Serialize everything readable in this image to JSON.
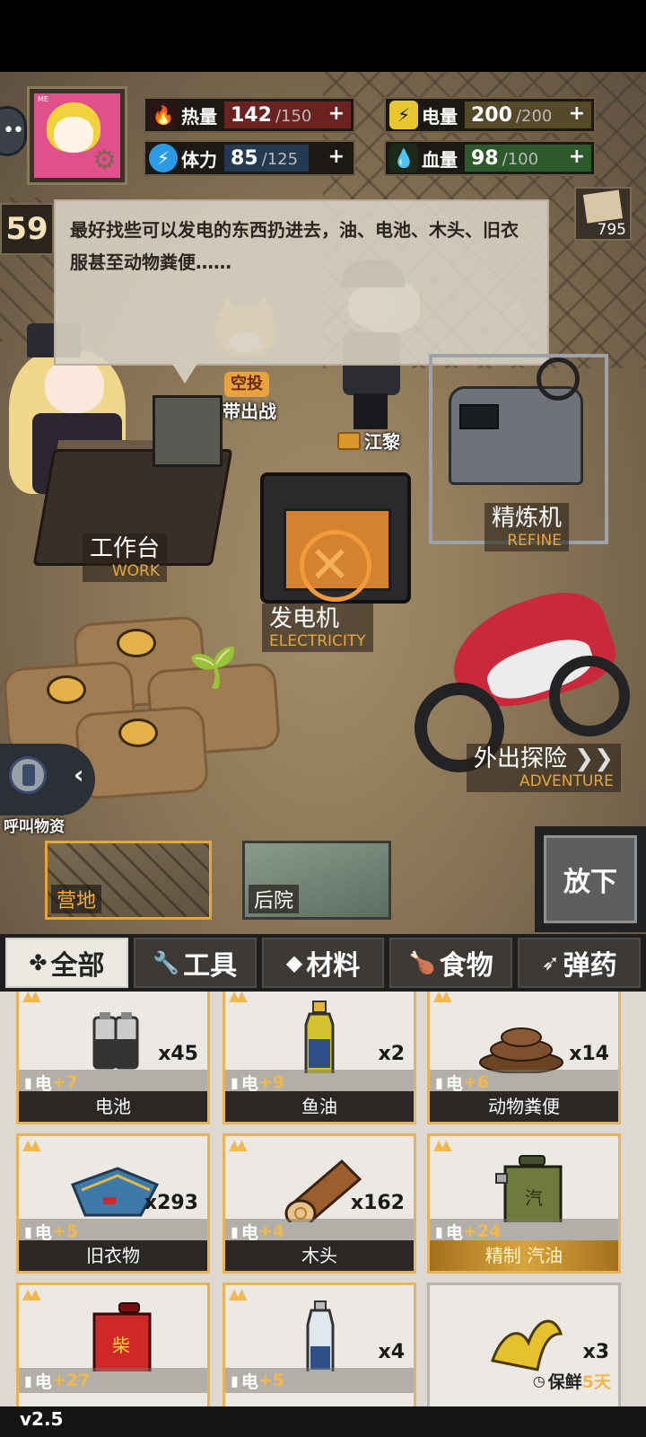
{
  "stats": {
    "heat": {
      "label": "热量",
      "value": "142",
      "max": "/150",
      "plus": "+",
      "color": "#e0392b"
    },
    "power": {
      "label": "电量",
      "value": "200",
      "max": "/200",
      "plus": "+",
      "color": "#e8c72e"
    },
    "stamina": {
      "label": "体力",
      "value": "85",
      "max": "/125",
      "plus": "+",
      "color": "#2b9be6"
    },
    "health": {
      "label": "血量",
      "value": "98",
      "max": "/100",
      "plus": "+",
      "color": "#58b84a"
    }
  },
  "level": "59",
  "paper_count": "795",
  "avatar_tag": "ME",
  "dialog": "最好找些可以发电的东西扔进去，油、电池、木头、旧衣服甚至动物粪便……",
  "characters": {
    "airdrop_badge": "空投",
    "carry_caption": "携带出战",
    "officer_name": "江黎"
  },
  "stations": {
    "workbench": {
      "cn": "工作台",
      "en": "WORK"
    },
    "refine": {
      "cn": "精炼机",
      "en": "REFINE"
    },
    "electricity": {
      "cn": "发电机",
      "en": "ELECTRICITY"
    },
    "adventure": {
      "cn": "外出探险",
      "en": "ADVENTURE"
    }
  },
  "radio_label": "呼叫物资",
  "locations": {
    "camp": "营地",
    "yard": "后院"
  },
  "putdown_label": "放下",
  "categories": {
    "all": "全部",
    "tools": "工具",
    "materials": "材料",
    "food": "食物",
    "ammo": "弹药"
  },
  "items": [
    {
      "name": "电池",
      "qty": "x45",
      "bonus_label": "电",
      "bonus": "+7",
      "image": "battery"
    },
    {
      "name": "鱼油",
      "qty": "x2",
      "bonus_label": "电",
      "bonus": "+9",
      "image": "fish-oil-bottle"
    },
    {
      "name": "动物粪便",
      "qty": "x14",
      "bonus_label": "电",
      "bonus": "+6",
      "image": "dung"
    },
    {
      "name": "旧衣物",
      "qty": "x293",
      "bonus_label": "电",
      "bonus": "+5",
      "image": "old-clothes"
    },
    {
      "name": "木头",
      "qty": "x162",
      "bonus_label": "电",
      "bonus": "+4",
      "image": "log"
    },
    {
      "name": "精制 汽油",
      "qty": "",
      "bonus_label": "电",
      "bonus": "+24",
      "image": "green-jerrycan"
    },
    {
      "name": "",
      "qty": "",
      "bonus_label": "电",
      "bonus": "+27",
      "image": "red-jerrycan"
    },
    {
      "name": "",
      "qty": "x4",
      "bonus_label": "电",
      "bonus": "+5",
      "image": "fish-oil-bottle-small"
    },
    {
      "name": "",
      "qty": "x3",
      "bonus_label": "保鲜",
      "bonus": "5天",
      "image": "banana-peel"
    }
  ],
  "jerrycan_green_glyph": "汽",
  "jerrycan_red_glyph": "柴",
  "version": "v2.5"
}
